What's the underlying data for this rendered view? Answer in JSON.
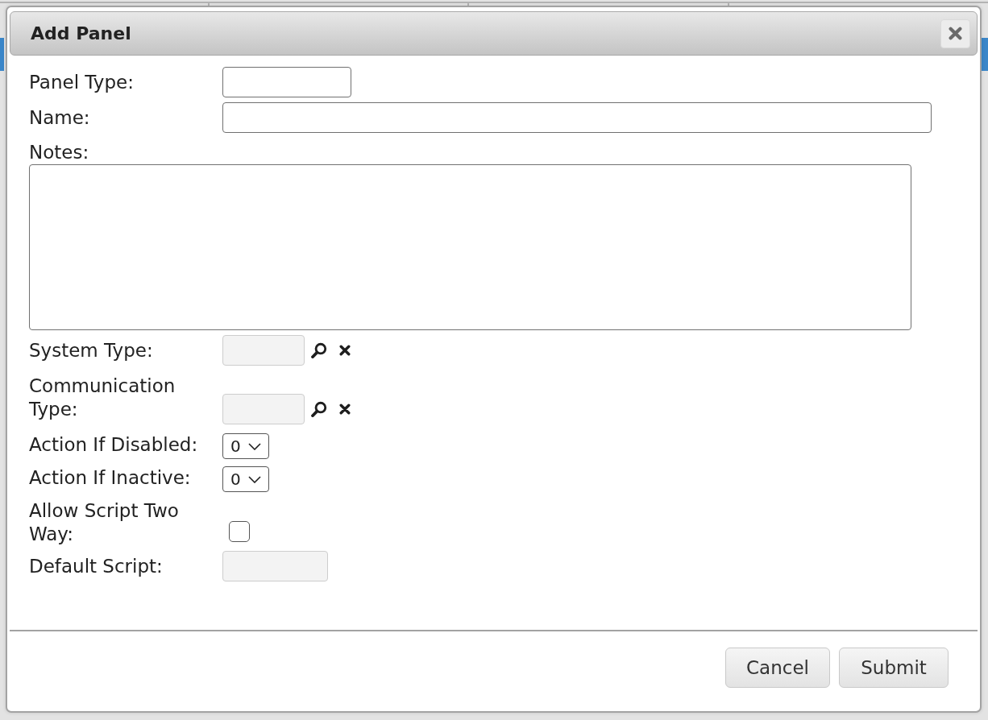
{
  "dialog": {
    "title": "Add Panel"
  },
  "fields": [
    {
      "kind": "short",
      "label": "Panel Type:",
      "disabled": false
    },
    {
      "kind": "wide",
      "label": "Name:",
      "disabled": false
    },
    {
      "kind": "area",
      "label": "Notes:",
      "disabled": false
    },
    {
      "kind": "lookup",
      "label": "System Type:",
      "disabled": true
    },
    {
      "kind": "lookup",
      "label": "Communication Type:",
      "disabled": true
    },
    {
      "kind": "select",
      "label": "Action If Disabled:",
      "value": "0"
    },
    {
      "kind": "select",
      "label": "Action If Inactive:",
      "value": "0"
    },
    {
      "kind": "checkbox",
      "label": "Allow Script Two Way:",
      "checked": false
    },
    {
      "kind": "short",
      "label": "Default Script:",
      "disabled": true
    }
  ],
  "buttons": [
    {
      "label": "Cancel"
    },
    {
      "label": "Submit"
    }
  ]
}
